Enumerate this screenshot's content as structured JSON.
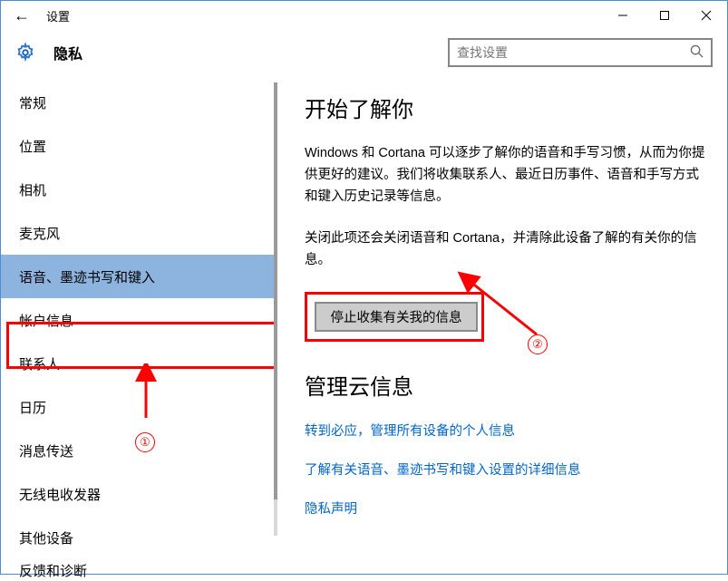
{
  "titlebar": {
    "back": "←",
    "title": "设置"
  },
  "header": {
    "page_title": "隐私",
    "search_placeholder": "查找设置"
  },
  "sidebar": {
    "items": [
      {
        "label": "常规"
      },
      {
        "label": "位置"
      },
      {
        "label": "相机"
      },
      {
        "label": "麦克风"
      },
      {
        "label": "语音、墨迹书写和键入"
      },
      {
        "label": "帐户信息"
      },
      {
        "label": "联系人"
      },
      {
        "label": "日历"
      },
      {
        "label": "消息传送"
      },
      {
        "label": "无线电收发器"
      },
      {
        "label": "其他设备"
      },
      {
        "label": "反馈和诊断"
      }
    ],
    "selected_index": 4
  },
  "content": {
    "heading1": "开始了解你",
    "para1": "Windows 和 Cortana 可以逐步了解你的语音和手写习惯，从而为你提供更好的建议。我们将收集联系人、最近日历事件、语音和手写方式和键入历史记录等信息。",
    "para2": "关闭此项还会关闭语音和 Cortana，并清除此设备了解的有关你的信息。",
    "stop_button": "停止收集有关我的信息",
    "heading2": "管理云信息",
    "link1": "转到必应，管理所有设备的个人信息",
    "link2": "了解有关语音、墨迹书写和键入设置的详细信息",
    "link3": "隐私声明"
  },
  "annotations": {
    "mark1": "①",
    "mark2": "②"
  }
}
